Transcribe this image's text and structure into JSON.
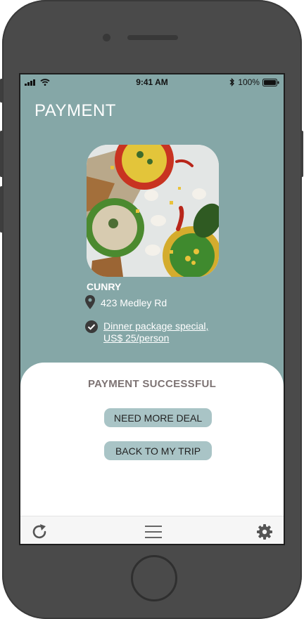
{
  "status_bar": {
    "time": "9:41 AM",
    "battery": "100%",
    "icons": [
      "signal-icon",
      "wifi-icon",
      "bluetooth-icon",
      "battery-icon"
    ]
  },
  "header": {
    "title": "PAYMENT"
  },
  "restaurant": {
    "name": "CUNRY",
    "address": "423 Medley Rd",
    "deal_line1": "Dinner package special,",
    "deal_line2": "US$ 25/person",
    "image": "food-image"
  },
  "sheet": {
    "title": "PAYMENT SUCCESSFUL",
    "primary_button": "NEED MORE DEAL",
    "secondary_button": "BACK TO MY TRIP"
  },
  "tab_bar": {
    "icons": [
      "refresh-icon",
      "menu-icon",
      "settings-icon"
    ]
  },
  "colors": {
    "screen_bg": "#85a7a7",
    "button_bg": "#a9c4c6",
    "sheet_title": "#7d7373",
    "phone_body": "#4a4a4a"
  }
}
